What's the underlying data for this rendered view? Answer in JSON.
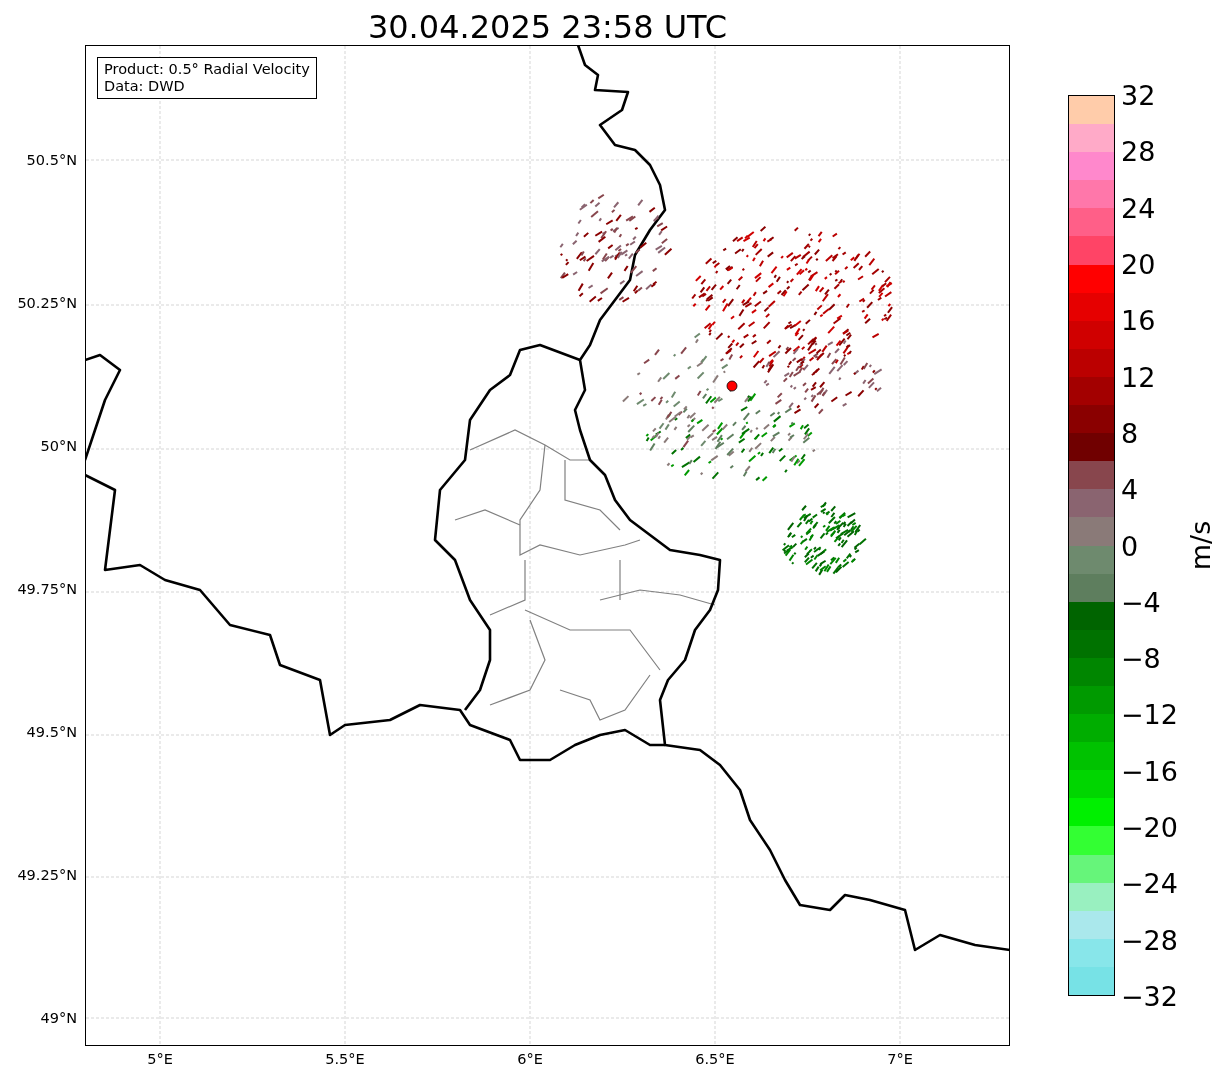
{
  "title": "30.04.2025 23:58 UTC",
  "legend": [
    "Product: 0.5° Radial Velocity",
    "Data: DWD"
  ],
  "lat_labels": [
    "50.5°N",
    "50.25°N",
    "50°N",
    "49.75°N",
    "49.5°N",
    "49.25°N",
    "49°N"
  ],
  "lon_labels": [
    "5°E",
    "5.5°E",
    "6°E",
    "6.5°E",
    "7°E"
  ],
  "colorbar": {
    "label": "m/s",
    "ticks": [
      "32",
      "28",
      "24",
      "20",
      "16",
      "12",
      "8",
      "4",
      "0",
      "−4",
      "−8",
      "−12",
      "−16",
      "−20",
      "−24",
      "−28",
      "−32"
    ],
    "segments": [
      {
        "color": "#ffccaa"
      },
      {
        "color": "#ffaac8"
      },
      {
        "color": "#ff88cc"
      },
      {
        "color": "#ff77aa"
      },
      {
        "color": "#ff5f88"
      },
      {
        "color": "#ff4466"
      },
      {
        "color": "#ff0000"
      },
      {
        "color": "#e60000"
      },
      {
        "color": "#d00000"
      },
      {
        "color": "#bb0000"
      },
      {
        "color": "#a30000"
      },
      {
        "color": "#8a0000"
      },
      {
        "color": "#700000"
      },
      {
        "color": "#88464d"
      },
      {
        "color": "#8a6470"
      },
      {
        "color": "#8a7a78"
      },
      {
        "color": "#6e8a6e"
      },
      {
        "color": "#5e7e5e"
      },
      {
        "color": "#006400"
      },
      {
        "color": "#007200"
      },
      {
        "color": "#008600"
      },
      {
        "color": "#009a00"
      },
      {
        "color": "#00ad00"
      },
      {
        "color": "#00c200"
      },
      {
        "color": "#00d600"
      },
      {
        "color": "#00f000"
      },
      {
        "color": "#33ff33"
      },
      {
        "color": "#66f57a"
      },
      {
        "color": "#99f0c0"
      },
      {
        "color": "#aae8ec"
      },
      {
        "color": "#88e6ea"
      },
      {
        "color": "#77e2e6"
      }
    ]
  }
}
